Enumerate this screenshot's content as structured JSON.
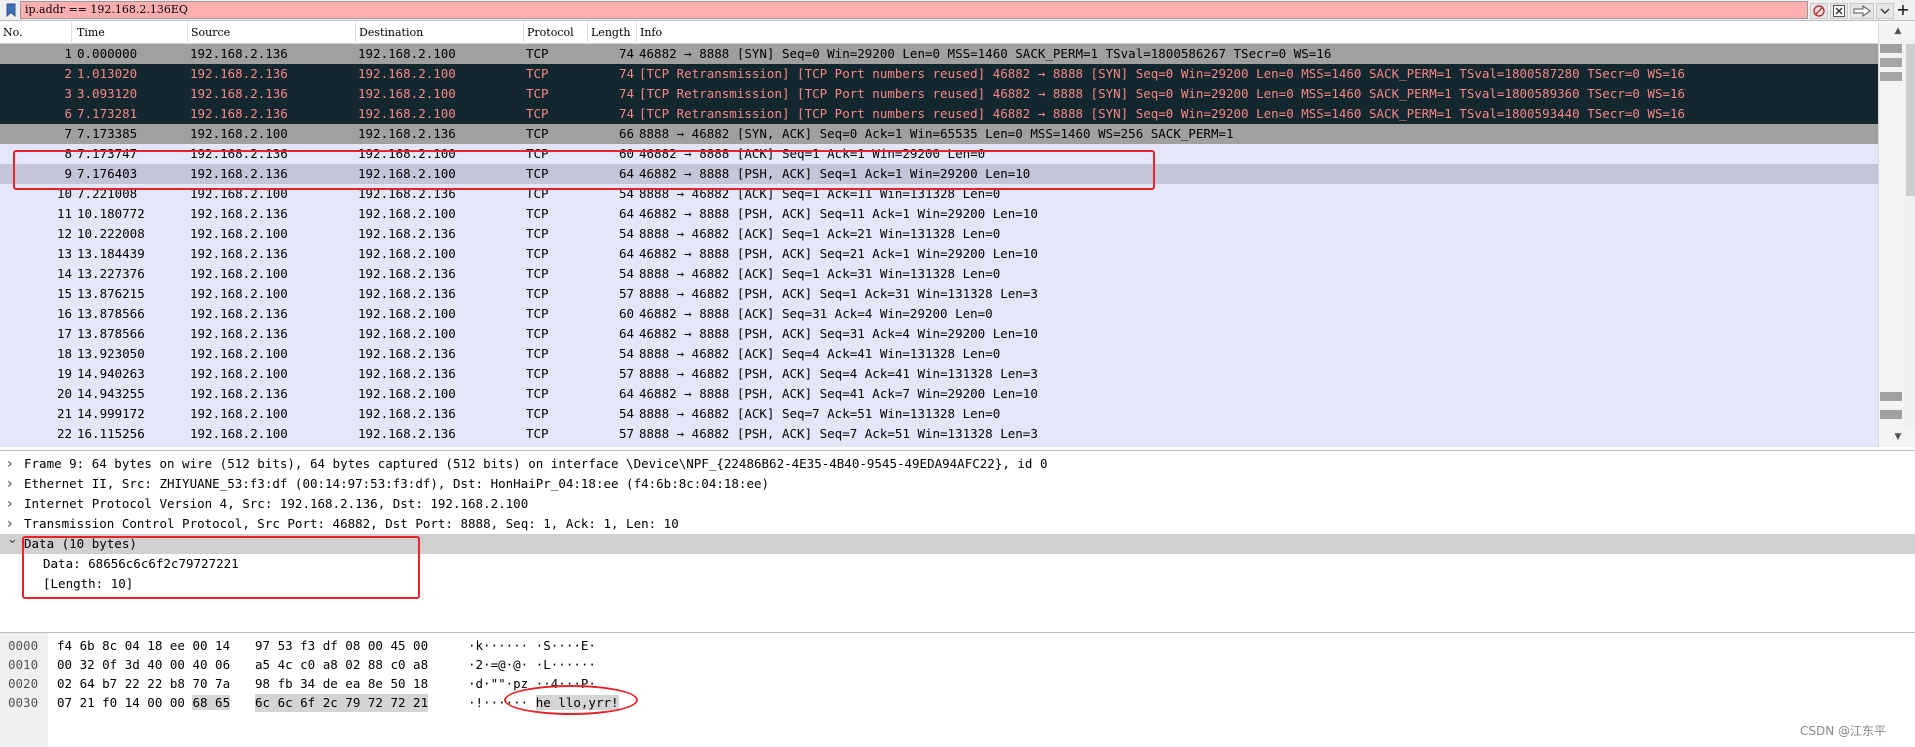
{
  "filter": {
    "value": "ip.addr == 192.168.2.136EQ",
    "add_label": "+"
  },
  "columns": [
    "No.",
    "Time",
    "Source",
    "Destination",
    "Protocol",
    "Length",
    "Info"
  ],
  "packets": [
    {
      "no": "1",
      "time": "0.000000",
      "src": "192.168.2.136",
      "dst": "192.168.2.100",
      "proto": "TCP",
      "len": "74",
      "info": "46882 → 8888 [SYN] Seq=0 Win=29200 Len=0 MSS=1460 SACK_PERM=1 TSval=1800586267 TSecr=0 WS=16",
      "style": "gray"
    },
    {
      "no": "2",
      "time": "1.013020",
      "src": "192.168.2.136",
      "dst": "192.168.2.100",
      "proto": "TCP",
      "len": "74",
      "info": "[TCP Retransmission] [TCP Port numbers reused] 46882 → 8888 [SYN] Seq=0 Win=29200 Len=0 MSS=1460 SACK_PERM=1 TSval=1800587280 TSecr=0 WS=16",
      "style": "dark"
    },
    {
      "no": "3",
      "time": "3.093120",
      "src": "192.168.2.136",
      "dst": "192.168.2.100",
      "proto": "TCP",
      "len": "74",
      "info": "[TCP Retransmission] [TCP Port numbers reused] 46882 → 8888 [SYN] Seq=0 Win=29200 Len=0 MSS=1460 SACK_PERM=1 TSval=1800589360 TSecr=0 WS=16",
      "style": "dark"
    },
    {
      "no": "6",
      "time": "7.173281",
      "src": "192.168.2.136",
      "dst": "192.168.2.100",
      "proto": "TCP",
      "len": "74",
      "info": "[TCP Retransmission] [TCP Port numbers reused] 46882 → 8888 [SYN] Seq=0 Win=29200 Len=0 MSS=1460 SACK_PERM=1 TSval=1800593440 TSecr=0 WS=16",
      "style": "dark"
    },
    {
      "no": "7",
      "time": "7.173385",
      "src": "192.168.2.100",
      "dst": "192.168.2.136",
      "proto": "TCP",
      "len": "66",
      "info": "8888 → 46882 [SYN, ACK] Seq=0 Ack=1 Win=65535 Len=0 MSS=1460 WS=256 SACK_PERM=1",
      "style": "gray"
    },
    {
      "no": "8",
      "time": "7.173747",
      "src": "192.168.2.136",
      "dst": "192.168.2.100",
      "proto": "TCP",
      "len": "60",
      "info": "46882 → 8888 [ACK] Seq=1 Ack=1 Win=29200 Len=0",
      "style": "normal"
    },
    {
      "no": "9",
      "time": "7.176403",
      "src": "192.168.2.136",
      "dst": "192.168.2.100",
      "proto": "TCP",
      "len": "64",
      "info": "46882 → 8888 [PSH, ACK] Seq=1 Ack=1 Win=29200 Len=10",
      "style": "sel"
    },
    {
      "no": "10",
      "time": "7.221008",
      "src": "192.168.2.100",
      "dst": "192.168.2.136",
      "proto": "TCP",
      "len": "54",
      "info": "8888 → 46882 [ACK] Seq=1 Ack=11 Win=131328 Len=0",
      "style": "normal"
    },
    {
      "no": "11",
      "time": "10.180772",
      "src": "192.168.2.136",
      "dst": "192.168.2.100",
      "proto": "TCP",
      "len": "64",
      "info": "46882 → 8888 [PSH, ACK] Seq=11 Ack=1 Win=29200 Len=10",
      "style": "normal"
    },
    {
      "no": "12",
      "time": "10.222008",
      "src": "192.168.2.100",
      "dst": "192.168.2.136",
      "proto": "TCP",
      "len": "54",
      "info": "8888 → 46882 [ACK] Seq=1 Ack=21 Win=131328 Len=0",
      "style": "normal"
    },
    {
      "no": "13",
      "time": "13.184439",
      "src": "192.168.2.136",
      "dst": "192.168.2.100",
      "proto": "TCP",
      "len": "64",
      "info": "46882 → 8888 [PSH, ACK] Seq=21 Ack=1 Win=29200 Len=10",
      "style": "normal"
    },
    {
      "no": "14",
      "time": "13.227376",
      "src": "192.168.2.100",
      "dst": "192.168.2.136",
      "proto": "TCP",
      "len": "54",
      "info": "8888 → 46882 [ACK] Seq=1 Ack=31 Win=131328 Len=0",
      "style": "normal"
    },
    {
      "no": "15",
      "time": "13.876215",
      "src": "192.168.2.100",
      "dst": "192.168.2.136",
      "proto": "TCP",
      "len": "57",
      "info": "8888 → 46882 [PSH, ACK] Seq=1 Ack=31 Win=131328 Len=3",
      "style": "normal"
    },
    {
      "no": "16",
      "time": "13.878566",
      "src": "192.168.2.136",
      "dst": "192.168.2.100",
      "proto": "TCP",
      "len": "60",
      "info": "46882 → 8888 [ACK] Seq=31 Ack=4 Win=29200 Len=0",
      "style": "normal"
    },
    {
      "no": "17",
      "time": "13.878566",
      "src": "192.168.2.136",
      "dst": "192.168.2.100",
      "proto": "TCP",
      "len": "64",
      "info": "46882 → 8888 [PSH, ACK] Seq=31 Ack=4 Win=29200 Len=10",
      "style": "normal"
    },
    {
      "no": "18",
      "time": "13.923050",
      "src": "192.168.2.100",
      "dst": "192.168.2.136",
      "proto": "TCP",
      "len": "54",
      "info": "8888 → 46882 [ACK] Seq=4 Ack=41 Win=131328 Len=0",
      "style": "normal"
    },
    {
      "no": "19",
      "time": "14.940263",
      "src": "192.168.2.100",
      "dst": "192.168.2.136",
      "proto": "TCP",
      "len": "57",
      "info": "8888 → 46882 [PSH, ACK] Seq=4 Ack=41 Win=131328 Len=3",
      "style": "normal"
    },
    {
      "no": "20",
      "time": "14.943255",
      "src": "192.168.2.136",
      "dst": "192.168.2.100",
      "proto": "TCP",
      "len": "64",
      "info": "46882 → 8888 [PSH, ACK] Seq=41 Ack=7 Win=29200 Len=10",
      "style": "normal"
    },
    {
      "no": "21",
      "time": "14.999172",
      "src": "192.168.2.100",
      "dst": "192.168.2.136",
      "proto": "TCP",
      "len": "54",
      "info": "8888 → 46882 [ACK] Seq=7 Ack=51 Win=131328 Len=0",
      "style": "normal"
    },
    {
      "no": "22",
      "time": "16.115256",
      "src": "192.168.2.100",
      "dst": "192.168.2.136",
      "proto": "TCP",
      "len": "57",
      "info": "8888 → 46882 [PSH, ACK] Seq=7 Ack=51 Win=131328 Len=3",
      "style": "normal"
    }
  ],
  "details": [
    {
      "text": "Frame 9: 64 bytes on wire (512 bits), 64 bytes captured (512 bits) on interface \\Device\\NPF_{22486B62-4E35-4B40-9545-49EDA94AFC22}, id 0",
      "expanded": false,
      "child": false,
      "selected": false
    },
    {
      "text": "Ethernet II, Src: ZHIYUANE_53:f3:df (00:14:97:53:f3:df), Dst: HonHaiPr_04:18:ee (f4:6b:8c:04:18:ee)",
      "expanded": false,
      "child": false,
      "selected": false
    },
    {
      "text": "Internet Protocol Version 4, Src: 192.168.2.136, Dst: 192.168.2.100",
      "expanded": false,
      "child": false,
      "selected": false
    },
    {
      "text": "Transmission Control Protocol, Src Port: 46882, Dst Port: 8888, Seq: 1, Ack: 1, Len: 10",
      "expanded": false,
      "child": false,
      "selected": false
    },
    {
      "text": "Data (10 bytes)",
      "expanded": true,
      "child": false,
      "selected": true
    },
    {
      "text": "Data: 68656c6c6f2c79727221",
      "expanded": false,
      "child": true,
      "selected": false
    },
    {
      "text": "[Length: 10]",
      "expanded": false,
      "child": true,
      "selected": false
    }
  ],
  "bytes": [
    {
      "offset": "0000",
      "hex1": "f4 6b 8c 04 18 ee 00 14",
      "hex2": "97 53 f3 df 08 00 45 00",
      "ascii": "·k······ ·S····E·"
    },
    {
      "offset": "0010",
      "hex1": "00 32 0f 3d 40 00 40 06",
      "hex2": "a5 4c c0 a8 02 88 c0 a8",
      "ascii": "·2·=@·@· ·L······"
    },
    {
      "offset": "0020",
      "hex1": "02 64 b7 22 22 b8 70 7a",
      "hex2": "98 fb 34 de ea 8e 50 18",
      "ascii": "·d·\"\"·pz ··4···P·"
    },
    {
      "offset": "0030",
      "hex1": "07 21 f0 14 00 00",
      "hex1_hl": "68 65",
      "hex2": "6c 6c 6f 2c 79 72 72 21",
      "ascii_pre": "·!······ ",
      "ascii_hl": "he llo,yrr!"
    }
  ],
  "watermark": "CSDN @江东平",
  "colors": {
    "filter_bg": "#ffafaf",
    "list_bg": "#e6e6fa",
    "row_gray": "#a0a0a0",
    "row_dark": "#12272e",
    "row_dark_text": "#f78787",
    "row_selected": "#c5c5d8",
    "annotation": "#e8232a"
  },
  "icons": {
    "filter_bookmark": "bookmark-icon",
    "clear": "clear-filter-icon",
    "close": "close-icon",
    "apply": "apply-arrow-icon",
    "dropdown": "chevron-down-icon"
  }
}
